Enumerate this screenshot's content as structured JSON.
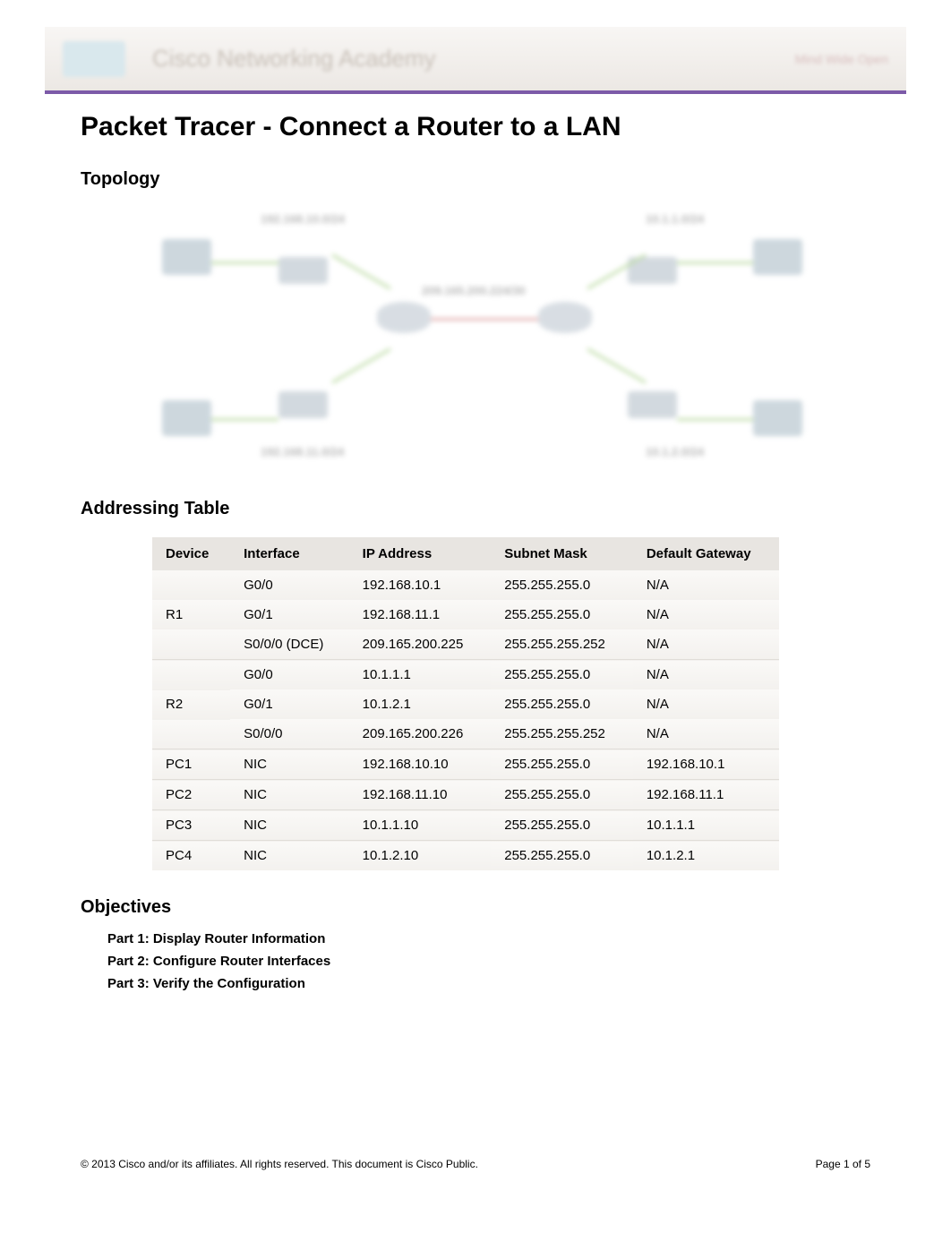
{
  "header": {
    "banner_text": "Cisco Networking Academy",
    "banner_right": "Mind Wide Open"
  },
  "main_title": "Packet Tracer - Connect a Router to a LAN",
  "sections": {
    "topology": "Topology",
    "addressing_table": "Addressing Table",
    "objectives": "Objectives"
  },
  "topology_labels": {
    "net1": "192.168.10.0/24",
    "net2": "10.1.1.0/24",
    "wan": "209.165.200.224/30",
    "net3": "192.168.11.0/24",
    "net4": "10.1.2.0/24"
  },
  "table": {
    "headers": {
      "device": "Device",
      "interface": "Interface",
      "ip": "IP Address",
      "mask": "Subnet Mask",
      "gateway": "Default Gateway"
    },
    "rows": [
      {
        "device": "R1",
        "rowspan": 3,
        "interface": "G0/0",
        "ip": "192.168.10.1",
        "mask": "255.255.255.0",
        "gateway": "N/A"
      },
      {
        "device": "",
        "interface": "G0/1",
        "ip": "192.168.11.1",
        "mask": "255.255.255.0",
        "gateway": "N/A"
      },
      {
        "device": "",
        "interface": "S0/0/0 (DCE)",
        "ip": "209.165.200.225",
        "mask": "255.255.255.252",
        "gateway": "N/A"
      },
      {
        "device": "R2",
        "rowspan": 3,
        "interface": "G0/0",
        "ip": "10.1.1.1",
        "mask": "255.255.255.0",
        "gateway": "N/A"
      },
      {
        "device": "",
        "interface": "G0/1",
        "ip": "10.1.2.1",
        "mask": "255.255.255.0",
        "gateway": "N/A"
      },
      {
        "device": "",
        "interface": "S0/0/0",
        "ip": "209.165.200.226",
        "mask": "255.255.255.252",
        "gateway": "N/A"
      },
      {
        "device": "PC1",
        "rowspan": 1,
        "interface": "NIC",
        "ip": "192.168.10.10",
        "mask": "255.255.255.0",
        "gateway": "192.168.10.1"
      },
      {
        "device": "PC2",
        "rowspan": 1,
        "interface": "NIC",
        "ip": "192.168.11.10",
        "mask": "255.255.255.0",
        "gateway": "192.168.11.1"
      },
      {
        "device": "PC3",
        "rowspan": 1,
        "interface": "NIC",
        "ip": "10.1.1.10",
        "mask": "255.255.255.0",
        "gateway": "10.1.1.1"
      },
      {
        "device": "PC4",
        "rowspan": 1,
        "interface": "NIC",
        "ip": "10.1.2.10",
        "mask": "255.255.255.0",
        "gateway": "10.1.2.1"
      }
    ]
  },
  "objectives": [
    "Part 1: Display Router Information",
    "Part 2: Configure Router Interfaces",
    "Part 3: Verify the Configuration"
  ],
  "footer": {
    "copyright": "© 2013 Cisco and/or its affiliates. All rights reserved. This document is Cisco Public.",
    "page_label": "Page 1 of 5"
  }
}
